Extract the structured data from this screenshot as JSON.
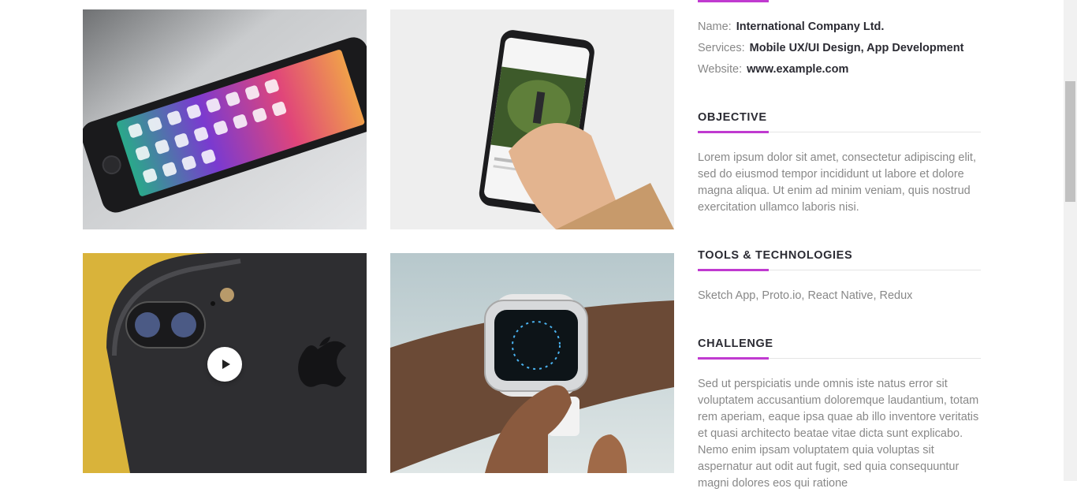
{
  "project_info": {
    "name_label": "Name:",
    "name_value": "International Company Ltd.",
    "services_label": "Services:",
    "services_value": "Mobile UX/UI Design, App Development",
    "website_label": "Website:",
    "website_value": "www.example.com"
  },
  "objective": {
    "title": "OBJECTIVE",
    "text": "Lorem ipsum dolor sit amet, consectetur adipiscing elit, sed do eiusmod tempor incididunt ut labore et dolore magna aliqua. Ut enim ad minim veniam, quis nostrud exercitation ullamco laboris nisi."
  },
  "tools": {
    "title": "TOOLS & TECHNOLOGIES",
    "text": "Sketch App, Proto.io, React Native, Redux"
  },
  "challenge": {
    "title": "CHALLENGE",
    "text": "Sed ut perspiciatis unde omnis iste natus error sit voluptatem accusantium doloremque laudantium, totam rem aperiam, eaque ipsa quae ab illo inventore veritatis et quasi architecto beatae vitae dicta sunt explicabo. Nemo enim ipsam voluptatem quia voluptas sit aspernatur aut odit aut fugit, sed quia consequuntur magni dolores eos qui ratione"
  },
  "gallery": {
    "images": [
      "iphone-home-screen-photo",
      "hand-holding-phone-photo",
      "iphone-back-camera-video-thumbnail",
      "smartwatch-on-wrist-photo"
    ],
    "play_icon": "play-icon"
  },
  "colors": {
    "accent": "#c03ad0",
    "heading": "#2b2b33",
    "body_text": "#888888"
  }
}
